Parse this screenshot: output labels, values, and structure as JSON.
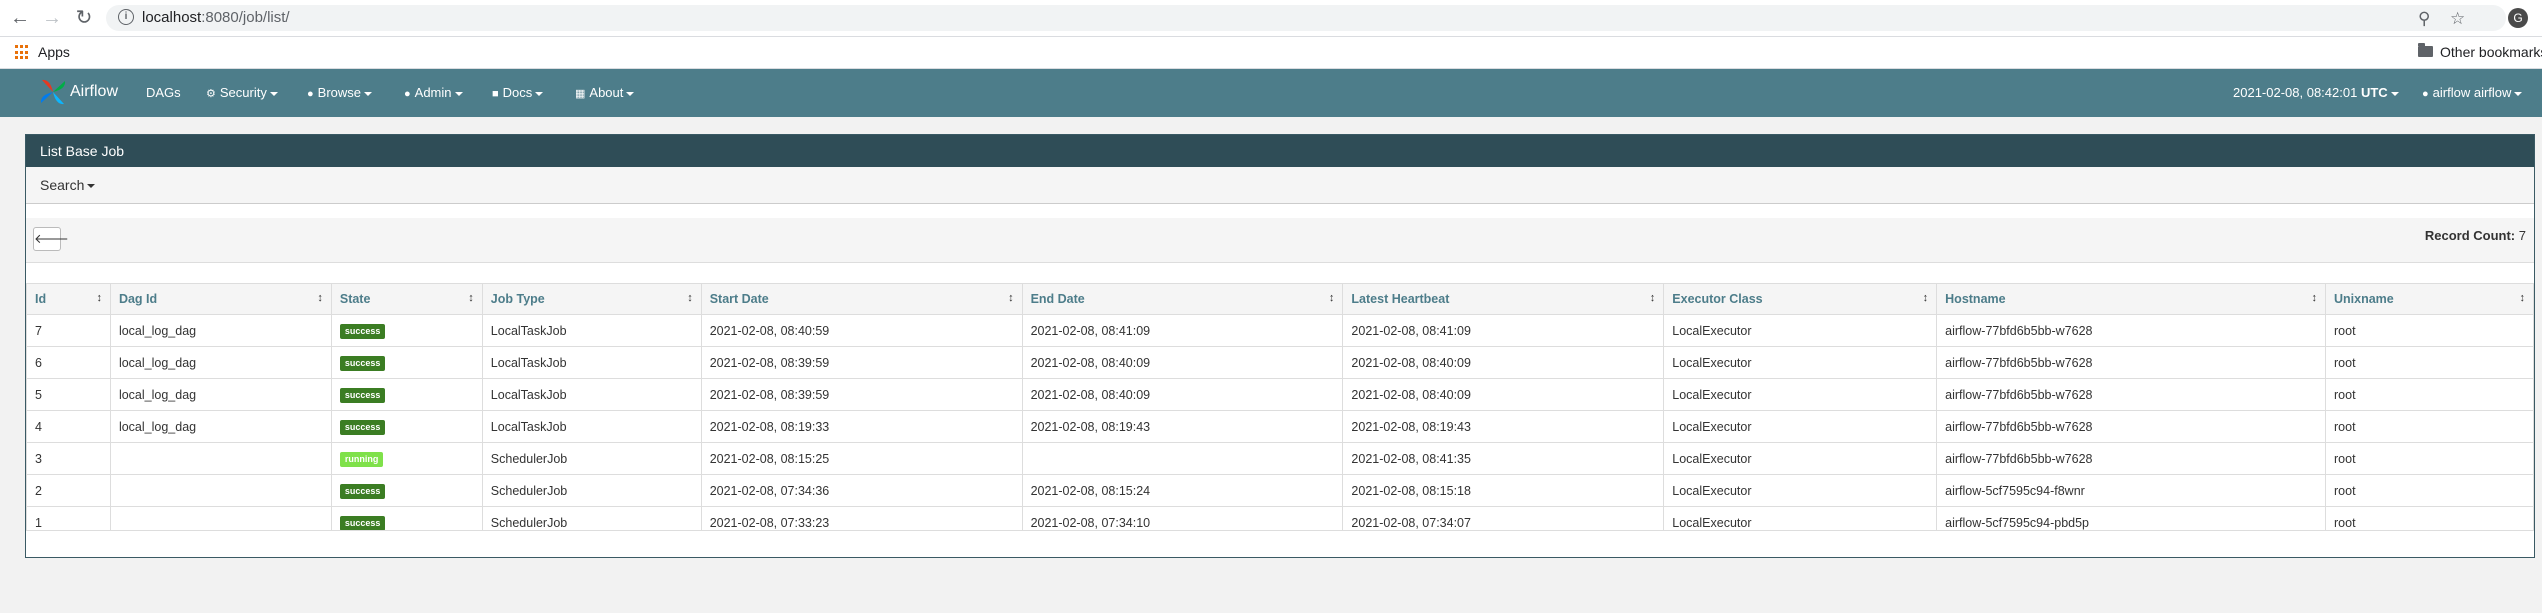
{
  "browser": {
    "url_host": "localhost",
    "url_path": ":8080/job/list/",
    "profile_initial": "G",
    "bookmarks": {
      "apps_label": "Apps",
      "other_label": "Other bookmarks"
    }
  },
  "navbar": {
    "brand": "Airflow",
    "items": [
      {
        "label": "DAGs"
      },
      {
        "label": "Security"
      },
      {
        "label": "Browse"
      },
      {
        "label": "Admin"
      },
      {
        "label": "Docs"
      },
      {
        "label": "About"
      }
    ],
    "timestamp": "2021-02-08, 08:42:01",
    "timezone": "UTC",
    "user": "airflow airflow"
  },
  "panel": {
    "title": "List Base Job",
    "search_label": "Search",
    "record_count_label": "Record Count:",
    "record_count": "7"
  },
  "table": {
    "columns": [
      "Id",
      "Dag Id",
      "State",
      "Job Type",
      "Start Date",
      "End Date",
      "Latest Heartbeat",
      "Executor Class",
      "Hostname",
      "Unixname"
    ],
    "rows": [
      {
        "id": "7",
        "dag_id": "local_log_dag",
        "state": "success",
        "job_type": "LocalTaskJob",
        "start": "2021-02-08, 08:40:59",
        "end": "2021-02-08, 08:41:09",
        "heartbeat": "2021-02-08, 08:41:09",
        "executor": "LocalExecutor",
        "hostname": "airflow-77bfd6b5bb-w7628",
        "unixname": "root"
      },
      {
        "id": "6",
        "dag_id": "local_log_dag",
        "state": "success",
        "job_type": "LocalTaskJob",
        "start": "2021-02-08, 08:39:59",
        "end": "2021-02-08, 08:40:09",
        "heartbeat": "2021-02-08, 08:40:09",
        "executor": "LocalExecutor",
        "hostname": "airflow-77bfd6b5bb-w7628",
        "unixname": "root"
      },
      {
        "id": "5",
        "dag_id": "local_log_dag",
        "state": "success",
        "job_type": "LocalTaskJob",
        "start": "2021-02-08, 08:39:59",
        "end": "2021-02-08, 08:40:09",
        "heartbeat": "2021-02-08, 08:40:09",
        "executor": "LocalExecutor",
        "hostname": "airflow-77bfd6b5bb-w7628",
        "unixname": "root"
      },
      {
        "id": "4",
        "dag_id": "local_log_dag",
        "state": "success",
        "job_type": "LocalTaskJob",
        "start": "2021-02-08, 08:19:33",
        "end": "2021-02-08, 08:19:43",
        "heartbeat": "2021-02-08, 08:19:43",
        "executor": "LocalExecutor",
        "hostname": "airflow-77bfd6b5bb-w7628",
        "unixname": "root"
      },
      {
        "id": "3",
        "dag_id": "",
        "state": "running",
        "job_type": "SchedulerJob",
        "start": "2021-02-08, 08:15:25",
        "end": "",
        "heartbeat": "2021-02-08, 08:41:35",
        "executor": "LocalExecutor",
        "hostname": "airflow-77bfd6b5bb-w7628",
        "unixname": "root"
      },
      {
        "id": "2",
        "dag_id": "",
        "state": "success",
        "job_type": "SchedulerJob",
        "start": "2021-02-08, 07:34:36",
        "end": "2021-02-08, 08:15:24",
        "heartbeat": "2021-02-08, 08:15:18",
        "executor": "LocalExecutor",
        "hostname": "airflow-5cf7595c94-f8wnr",
        "unixname": "root"
      },
      {
        "id": "1",
        "dag_id": "",
        "state": "success",
        "job_type": "SchedulerJob",
        "start": "2021-02-08, 07:33:23",
        "end": "2021-02-08, 07:34:10",
        "heartbeat": "2021-02-08, 07:34:07",
        "executor": "LocalExecutor",
        "hostname": "airflow-5cf7595c94-pbd5p",
        "unixname": "root"
      }
    ]
  },
  "colors": {
    "navbar": "#4d7d8a",
    "panel_header": "#2f4d57",
    "success": "#3b7d23",
    "running": "#7fe14a"
  },
  "icons": {
    "back": "arrow-left-icon",
    "forward": "arrow-right-icon",
    "reload": "reload-icon",
    "info": "info-icon",
    "zoom": "zoom-icon",
    "star": "star-icon",
    "apps": "apps-grid-icon",
    "folder": "folder-icon",
    "sort": "sort-icon"
  }
}
